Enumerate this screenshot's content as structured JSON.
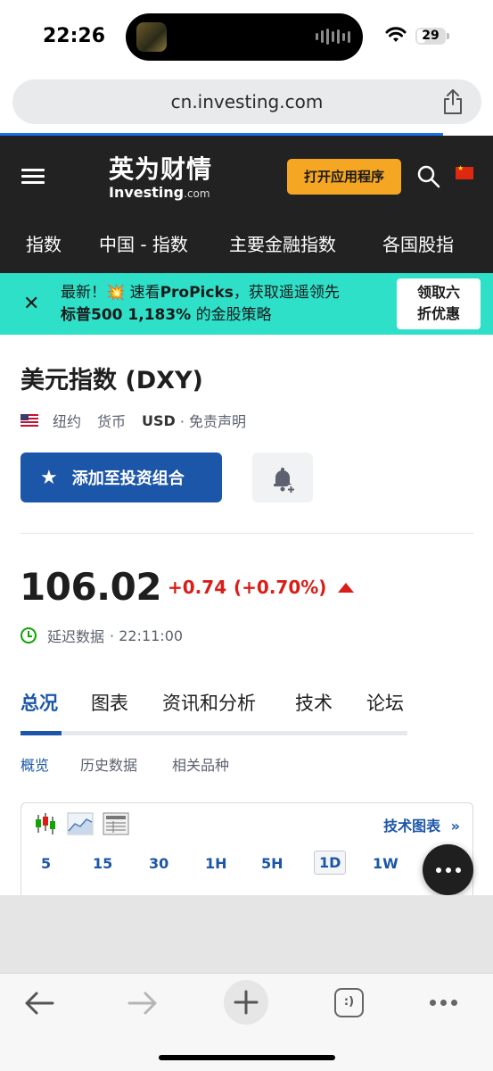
{
  "status_bar": {
    "time": "22:26",
    "battery": "29"
  },
  "browser": {
    "url": "cn.investing.com"
  },
  "header": {
    "logo_cn": "英为财情",
    "logo_en": "Investing",
    "logo_en_suffix": ".com",
    "open_app_label": "打开应用程序",
    "nav": [
      "指数",
      "中国 - 指数",
      "主要金融指数",
      "各国股指"
    ]
  },
  "promo": {
    "line1_prefix": "最新！",
    "line1_emoji": "💥",
    "line1_mid": " 速看",
    "line1_bold": "ProPicks",
    "line1_suffix": "，获取遥遥领先",
    "line2_bold": "标普500 1,183%",
    "line2_suffix": " 的金股策略",
    "cta_line1": "领取六",
    "cta_line2": "折优惠"
  },
  "instrument": {
    "title": "美元指数 (DXY)",
    "exchange": "纽约",
    "currency_label": "货币",
    "currency": "USD",
    "disclaimer": "· 免责声明",
    "add_portfolio_label": "添加至投资组合",
    "price": "106.02",
    "change": "+0.74",
    "change_pct": "(+0.70%)",
    "delay_label": "延迟数据",
    "delay_time": "· 22:11:00"
  },
  "tabs": [
    "总况",
    "图表",
    "资讯和分析",
    "技术",
    "论坛"
  ],
  "subtabs": [
    "概览",
    "历史数据",
    "相关品种"
  ],
  "chart_widget": {
    "tech_chart_label": "技术图表",
    "tech_chart_arrow": "»",
    "intervals": [
      "5",
      "15",
      "30",
      "1H",
      "5H",
      "1D",
      "1W"
    ],
    "active_interval": "1D"
  },
  "toolbar": {
    "tabs_label": ":)"
  },
  "colors": {
    "brand_blue": "#1c56a8",
    "negative_red": "#d91e18",
    "promo_teal": "#2fe0c8",
    "open_app_orange": "#f5a623",
    "header_dark": "#222222"
  }
}
